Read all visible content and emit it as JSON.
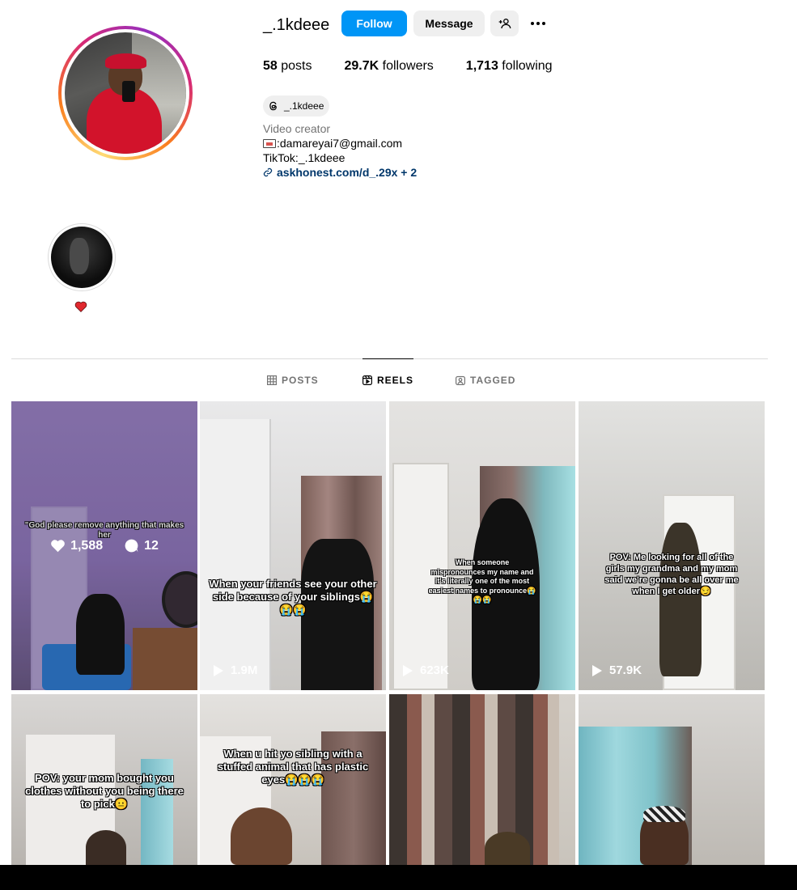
{
  "profile": {
    "username": "_.1kdeee",
    "follow_label": "Follow",
    "message_label": "Message",
    "stats": {
      "posts_count": "58",
      "posts_label": "posts",
      "followers_count": "29.7K",
      "followers_label": "followers",
      "following_count": "1,713",
      "following_label": "following"
    },
    "threads_handle": "_.1kdeee",
    "bio": {
      "category": "Video creator",
      "email": ":damareyai7@gmail.com",
      "tiktok": "TikTok:_.1kdeee",
      "link": "askhonest.com/d_.29x + 2"
    }
  },
  "highlights": [
    {
      "label": "heart-emoji"
    }
  ],
  "tabs": [
    {
      "label": "POSTS",
      "icon": "grid-icon"
    },
    {
      "label": "REELS",
      "icon": "reels-icon",
      "active": true
    },
    {
      "label": "TAGGED",
      "icon": "tagged-icon"
    }
  ],
  "reels": [
    {
      "caption": "\"God please remove anything that makes her",
      "likes": "1,588",
      "comments": "12",
      "hovered": true
    },
    {
      "caption": "When your friends see your other side because of your siblings😭😭😭",
      "views": "1.9M"
    },
    {
      "caption": "When someone mispronounces my name and it's literally one of the most easiest names to pronounce😭😭😭",
      "views": "623K"
    },
    {
      "caption": "POV: Me looking for all of the girls my grandma and my mom said we're gonna be all over me when I get older😏",
      "views": "57.9K"
    },
    {
      "caption": "POV: your mom bought you clothes without you being there to pick😐"
    },
    {
      "caption": "When u hit yo sibling with a stuffed animal that has plastic eyes😭😭😭"
    },
    {
      "caption": ""
    },
    {
      "caption": ""
    }
  ],
  "colors": {
    "accent": "#0095f6",
    "link": "#00376b",
    "secondary_text": "#737373",
    "button_bg": "#efefef"
  }
}
